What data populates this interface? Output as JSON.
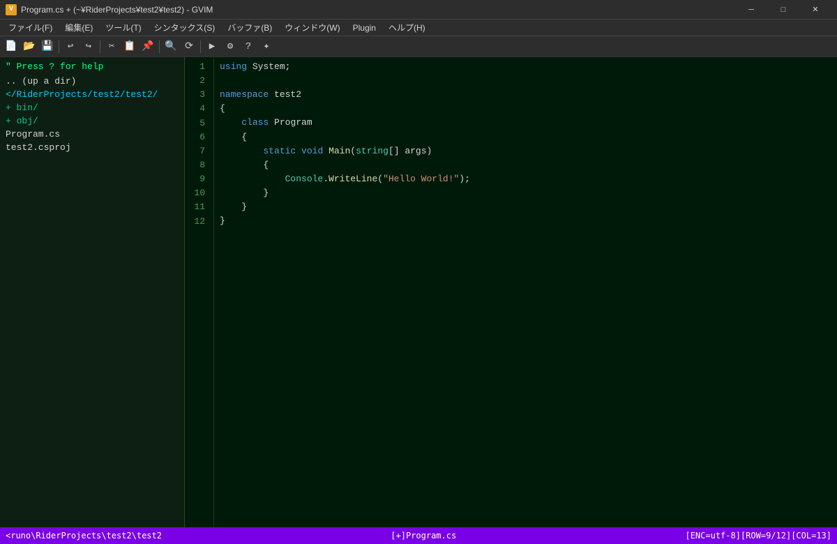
{
  "titlebar": {
    "icon": "V",
    "title": "Program.cs + (~¥RiderProjects¥test2¥test2) - GVIM",
    "minimize": "─",
    "maximize": "□",
    "close": "✕"
  },
  "menubar": {
    "items": [
      "ファイル(F)",
      "編集(E)",
      "ツール(T)",
      "シンタックス(S)",
      "バッファ(B)",
      "ウィンドウ(W)",
      "Plugin",
      "ヘルプ(H)"
    ]
  },
  "sidebar": {
    "help_text": "\" Press ? for help",
    "items": [
      {
        "type": "up-dir",
        "label": ".. (up a dir)"
      },
      {
        "type": "dir-path",
        "label": "</RiderProjects/test2/test2/"
      },
      {
        "type": "dir-entry",
        "label": "+ bin/"
      },
      {
        "type": "dir-entry",
        "label": "+ obj/"
      },
      {
        "type": "file-entry",
        "label": "  Program.cs"
      },
      {
        "type": "file-entry",
        "label": "  test2.csproj"
      }
    ]
  },
  "editor": {
    "lines": [
      {
        "num": "1",
        "tokens": [
          {
            "cls": "kw",
            "t": "using"
          },
          {
            "cls": "plain",
            "t": " System;"
          }
        ]
      },
      {
        "num": "2",
        "tokens": [
          {
            "cls": "plain",
            "t": ""
          }
        ]
      },
      {
        "num": "3",
        "tokens": [
          {
            "cls": "kw",
            "t": "namespace"
          },
          {
            "cls": "plain",
            "t": " test2"
          }
        ]
      },
      {
        "num": "4",
        "tokens": [
          {
            "cls": "plain",
            "t": "{"
          }
        ]
      },
      {
        "num": "5",
        "tokens": [
          {
            "cls": "plain",
            "t": "    "
          },
          {
            "cls": "kw",
            "t": "class"
          },
          {
            "cls": "plain",
            "t": " Program"
          }
        ]
      },
      {
        "num": "6",
        "tokens": [
          {
            "cls": "plain",
            "t": "    {"
          }
        ]
      },
      {
        "num": "7",
        "tokens": [
          {
            "cls": "plain",
            "t": "        "
          },
          {
            "cls": "kw",
            "t": "static"
          },
          {
            "cls": "plain",
            "t": " "
          },
          {
            "cls": "kw",
            "t": "void"
          },
          {
            "cls": "plain",
            "t": " "
          },
          {
            "cls": "method",
            "t": "Main"
          },
          {
            "cls": "plain",
            "t": "("
          },
          {
            "cls": "type",
            "t": "string"
          },
          {
            "cls": "plain",
            "t": "[] args)"
          }
        ]
      },
      {
        "num": "8",
        "tokens": [
          {
            "cls": "plain",
            "t": "        {"
          }
        ]
      },
      {
        "num": "9",
        "tokens": [
          {
            "cls": "plain",
            "t": "            "
          },
          {
            "cls": "type",
            "t": "Console"
          },
          {
            "cls": "plain",
            "t": "."
          },
          {
            "cls": "method",
            "t": "WriteLine"
          },
          {
            "cls": "plain",
            "t": "("
          },
          {
            "cls": "string",
            "t": "\"Hello World!\""
          },
          {
            "cls": "plain",
            "t": ");"
          }
        ]
      },
      {
        "num": "10",
        "tokens": [
          {
            "cls": "plain",
            "t": "        }"
          }
        ]
      },
      {
        "num": "11",
        "tokens": [
          {
            "cls": "plain",
            "t": "    }"
          }
        ]
      },
      {
        "num": "12",
        "tokens": [
          {
            "cls": "plain",
            "t": "}"
          }
        ]
      }
    ]
  },
  "statusbar": {
    "left": "<runo\\RiderProjects\\test2\\test2",
    "middle": "[+]Program.cs",
    "right": "[ENC=utf-8][ROW=9/12][COL=13]"
  }
}
